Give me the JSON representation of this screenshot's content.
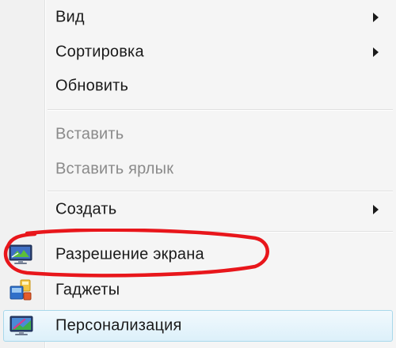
{
  "menu": {
    "items": [
      {
        "label": "Вид",
        "has_submenu": true,
        "disabled": false
      },
      {
        "label": "Сортировка",
        "has_submenu": true,
        "disabled": false
      },
      {
        "label": "Обновить",
        "has_submenu": false,
        "disabled": false
      },
      {
        "label": "Вставить",
        "has_submenu": false,
        "disabled": true
      },
      {
        "label": "Вставить ярлык",
        "has_submenu": false,
        "disabled": true
      },
      {
        "label": "Создать",
        "has_submenu": true,
        "disabled": false
      },
      {
        "label": "Разрешение экрана",
        "has_submenu": false,
        "disabled": false,
        "icon": "monitor-resolution-icon"
      },
      {
        "label": "Гаджеты",
        "has_submenu": false,
        "disabled": false,
        "icon": "gadgets-icon"
      },
      {
        "label": "Персонализация",
        "has_submenu": false,
        "disabled": false,
        "icon": "personalization-icon",
        "hovered": true
      }
    ]
  },
  "colors": {
    "annotation": "#e8161b",
    "hover_border": "#a8d8eb",
    "disabled_text": "#8a8a8a",
    "background": "#f5f5f5"
  }
}
